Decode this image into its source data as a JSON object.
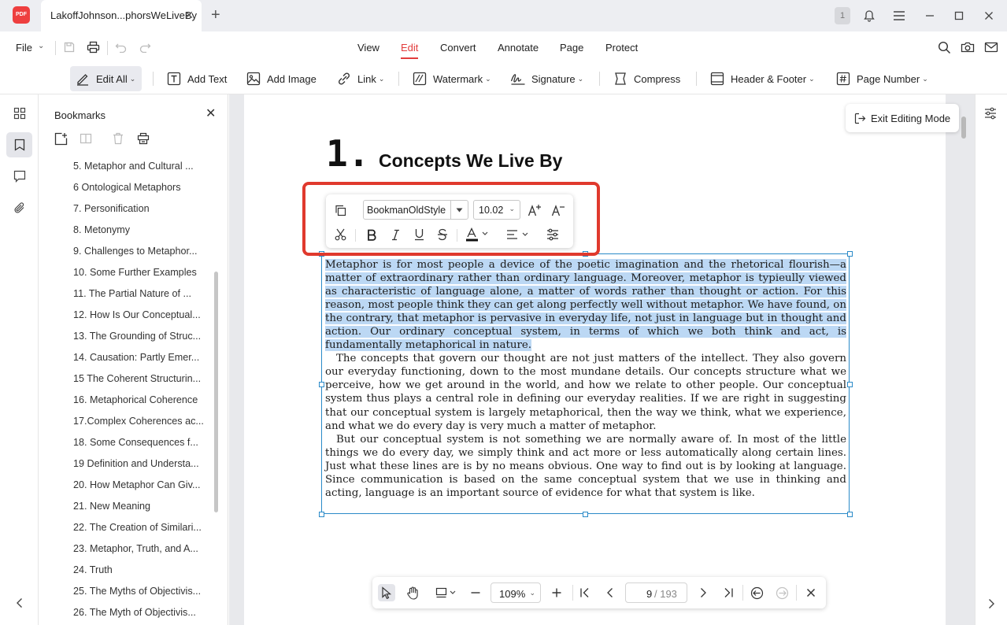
{
  "titlebar": {
    "logo_text": "PDF",
    "tab_title": "LakoffJohnson...phorsWeLiveBy",
    "tab_close": "✕",
    "new_tab": "+",
    "page_count_badge": "1"
  },
  "menubar": {
    "file_label": "File",
    "items": [
      "View",
      "Edit",
      "Convert",
      "Annotate",
      "Page",
      "Protect"
    ],
    "active_item": "Edit"
  },
  "ribbon": {
    "edit_all": "Edit All",
    "add_text": "Add Text",
    "add_image": "Add Image",
    "link": "Link",
    "watermark": "Watermark",
    "signature": "Signature",
    "compress": "Compress",
    "header_footer": "Header & Footer",
    "page_number": "Page Number"
  },
  "bookmarks": {
    "title": "Bookmarks",
    "close": "✕",
    "items": [
      "5. Metaphor and Cultural ...",
      "6 Ontological Metaphors",
      "7. Personification",
      "8. Metonymy",
      "9. Challenges to Metaphor...",
      "10. Some Further Examples",
      "11. The Partial Nature of ...",
      "12. How Is Our Conceptual...",
      "13. The Grounding of Struc...",
      "14. Causation: Partly Emer...",
      "15 The Coherent Structurin...",
      "16. Metaphorical Coherence",
      "17.Complex Coherences ac...",
      "18. Some Consequences f...",
      "19 Definition and Understa...",
      "20. How Metaphor Can Giv...",
      "21. New Meaning",
      "22. The Creation of Similari...",
      "23. Metaphor, Truth, and A...",
      "24. Truth",
      "25. The Myths of Objectivis...",
      "26. The Myth of Objectivis..."
    ]
  },
  "document": {
    "chapter_number": "1.",
    "chapter_title": "Concepts We Live By",
    "paragraph1": "Metaphor is for most people a device of the poetic imagination and the rhetorical flourish—a matter of extraordinary rather than ordinary language. Moreover, metaphor is typieully viewed as characteristic of language alone, a matter of words rather than thought or action. For this reason, most people think they can get along perfectly well without metaphor. We have found, on the contrary, that metaphor is pervasive in everyday life, not just in language but in thought and action. Our ordinary conceptual system, in terms of which we both think and act, is fundamentally metaphorical in nature.",
    "paragraph2": "The concepts that govern our thought are not just matters of the intellect. They also govern our everyday functioning, down to the most mundane details. Our concepts structure what we perceive, how we get around in the world, and how we relate to other people. Our conceptual system thus plays a central role in defining our everyday realities. If we are right in suggesting that our conceptual system is largely metaphorical, then the way we think, what we experience, and what we do every day is very much a matter of metaphor.",
    "paragraph3": "But our conceptual system is not something we are normally aware of. In most of the little things we do every day, we simply think and act more or less automatically along certain lines. Just what these lines are is by no means obvious. One way to find out is by looking at language. Since communication is based on the same conceptual system that we use in thinking and acting, language is an important source of evidence for what that system is like."
  },
  "format_toolbar": {
    "font_name": "BookmanOldStyle",
    "font_size": "10.02"
  },
  "exit_editing": "Exit Editing Mode",
  "navbar": {
    "zoom": "109%",
    "current_page": "9",
    "total_pages": "/ 193"
  },
  "colors": {
    "accent": "#e23c3c",
    "highlight_box": "#e0392d",
    "selection": "#bcd8f4",
    "frame_blue": "#2a8ac8"
  }
}
